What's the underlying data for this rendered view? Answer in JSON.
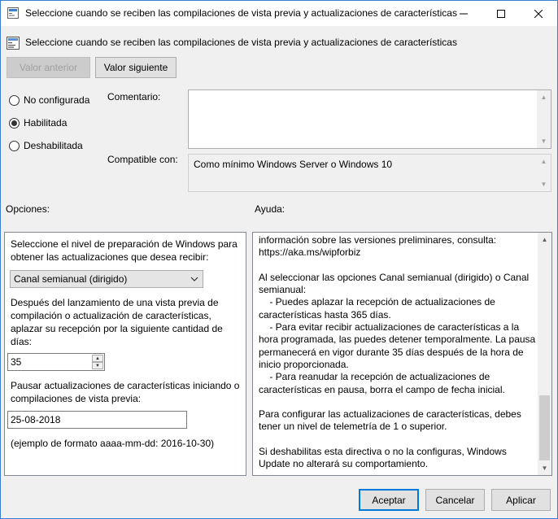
{
  "window": {
    "title": "Seleccione cuando se reciben las compilaciones de vista previa y actualizaciones de características"
  },
  "header": {
    "policy_title": "Seleccione cuando se reciben las compilaciones de vista previa y actualizaciones de características"
  },
  "nav": {
    "prev_label": "Valor anterior",
    "next_label": "Valor siguiente"
  },
  "state": {
    "options": [
      {
        "label": "No configurada",
        "checked": false
      },
      {
        "label": "Habilitada",
        "checked": true
      },
      {
        "label": "Deshabilitada",
        "checked": false
      }
    ]
  },
  "comment": {
    "label": "Comentario:",
    "value": ""
  },
  "compatible": {
    "label": "Compatible con:",
    "value": "Como mínimo Windows Server o Windows 10"
  },
  "options_panel": {
    "label": "Opciones:",
    "level_prompt": "Seleccione el nivel de preparación de Windows para obtener las actualizaciones que desea recibir:",
    "level_value": "Canal semianual (dirigido)",
    "defer_prompt": "Después del lanzamiento de una vista previa de compilación o actualización de características, aplazar su recepción por la siguiente cantidad de días:",
    "defer_days": "35",
    "pause_prompt": "Pausar actualizaciones de características iniciando o compilaciones de vista previa:",
    "pause_date": "25-08-2018",
    "format_hint": "(ejemplo de formato aaaa-mm-dd: 2016-10-30)"
  },
  "help_panel": {
    "label": "Ayuda:",
    "text": "información sobre las versiones preliminares, consulta:\nhttps://aka.ms/wipforbiz\n\nAl seleccionar las opciones Canal semianual (dirigido) o Canal semianual:\n    - Puedes aplazar la recepción de actualizaciones de características hasta 365 días.\n    - Para evitar recibir actualizaciones de características a la hora programada, las puedes detener temporalmente. La pausa permanecerá en vigor durante 35 días después de la hora de inicio proporcionada.\n    - Para reanudar la recepción de actualizaciones de características en pausa, borra el campo de fecha inicial.\n\nPara configurar las actualizaciones de características, debes tener un nivel de telemetría de 1 o superior.\n\nSi deshabilitas esta directiva o no la configuras, Windows Update no alterará su comportamiento."
  },
  "footer": {
    "ok_label": "Aceptar",
    "cancel_label": "Cancelar",
    "apply_label": "Aplicar"
  },
  "colors": {
    "accent": "#0078d7",
    "window_border": "#3a7fd0",
    "background": "#f0f0f0"
  }
}
